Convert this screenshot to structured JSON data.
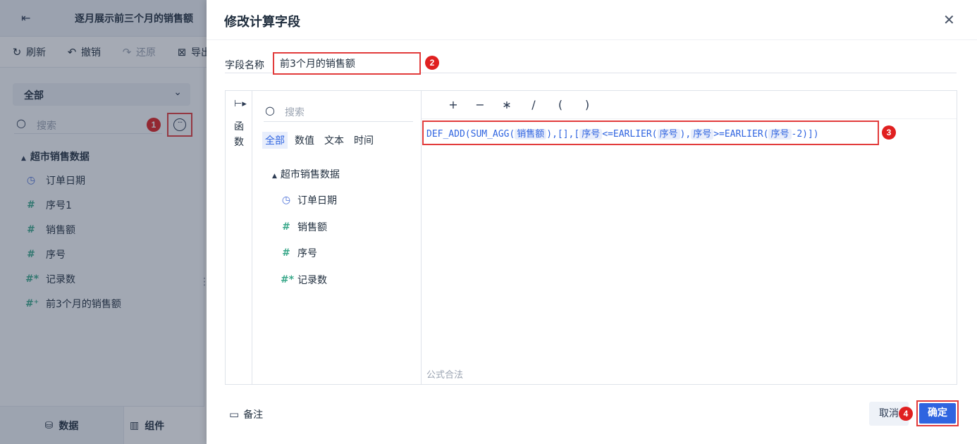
{
  "app": {
    "report_title": "逐月展示前三个月的销售额",
    "toolbar": {
      "refresh": "刷新",
      "undo": "撤销",
      "redo": "还原",
      "export": "导出"
    },
    "left_panel": {
      "dataset_select": "全部",
      "search_placeholder": "搜索",
      "tree_root": "超市销售数据",
      "fields": [
        {
          "icon": "clock-icon",
          "label": "订单日期"
        },
        {
          "icon": "hash-icon",
          "label": "序号1"
        },
        {
          "icon": "hash-icon",
          "label": "销售额"
        },
        {
          "icon": "hash-icon",
          "label": "序号"
        },
        {
          "icon": "hash-star-icon",
          "label": "记录数"
        },
        {
          "icon": "hash-calc-icon",
          "label": "前3个月的销售额"
        }
      ],
      "bottom_tabs": {
        "data": "数据",
        "components": "组件"
      }
    }
  },
  "annotations": {
    "step1": "1",
    "step2": "2",
    "step3": "3",
    "step4": "4"
  },
  "dialog": {
    "title": "修改计算字段",
    "field_name_label": "字段名称",
    "field_name_value": "前3个月的销售额",
    "function_rail": {
      "label_1": "函",
      "label_2": "数"
    },
    "fields_panel": {
      "search_placeholder": "搜索",
      "tabs": [
        "全部",
        "数值",
        "文本",
        "时间"
      ],
      "active_tab": "全部",
      "tree_root": "超市销售数据",
      "fields": [
        {
          "icon": "clock-icon",
          "label": "订单日期"
        },
        {
          "icon": "hash-icon",
          "label": "销售额"
        },
        {
          "icon": "hash-icon",
          "label": "序号"
        },
        {
          "icon": "hash-star-icon",
          "label": "记录数"
        }
      ]
    },
    "operators": [
      "+",
      "−",
      "∗",
      "/",
      "(",
      ")"
    ],
    "formula": {
      "p1": "DEF_ADD(SUM_AGG(",
      "f1": "销售额",
      "p2": "),[],[",
      "f2": "序号",
      "p3": "<=EARLIER(",
      "f3": "序号",
      "p4": "),",
      "f4": "序号",
      "p5": ">=EARLIER(",
      "f5": "序号",
      "p6": "-2)])"
    },
    "validation_text": "公式合法",
    "note_label": "备注",
    "cancel_label": "取消",
    "confirm_label": "确定"
  }
}
